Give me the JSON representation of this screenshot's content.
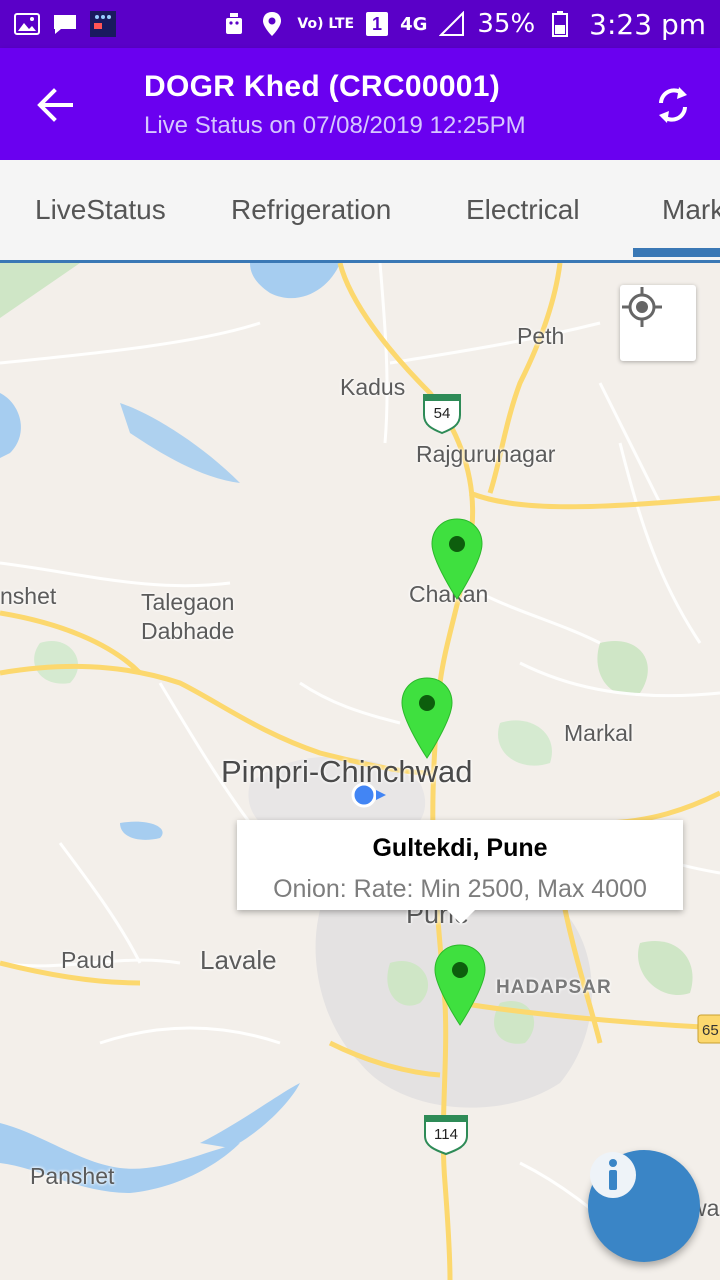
{
  "status_bar": {
    "network_label": "Vo) LTE",
    "sim_slot": "1",
    "network_type": "4G",
    "battery_percent": "35%",
    "time": "3:23 pm",
    "icons": [
      "gallery-icon",
      "message-icon",
      "app-notification-icon",
      "android-icon",
      "location-icon",
      "sim-icon",
      "signal-icon",
      "battery-icon"
    ]
  },
  "appbar": {
    "title": "DOGR Khed (CRC00001)",
    "subtitle": "Live Status on 07/08/2019 12:25PM",
    "icons": [
      "back-arrow-icon",
      "refresh-icon"
    ],
    "colors": {
      "background": "#6a00f0",
      "status_bar": "#5a00c8"
    }
  },
  "tabs": [
    {
      "label": "LiveStatus"
    },
    {
      "label": "Refrigeration"
    },
    {
      "label": "Electrical"
    },
    {
      "label": "Mark",
      "selected": true
    }
  ],
  "map": {
    "labels": {
      "peth": "Peth",
      "kadus": "Kadus",
      "rajgurunagar": "Rajgurunagar",
      "chakan": "Chakan",
      "nshet": "nshet",
      "talegaon": "Talegaon",
      "dabhade": "Dabhade",
      "markal": "Markal",
      "pimpri": "Pimpri-Chinchwad",
      "paud": "Paud",
      "lavale": "Lavale",
      "pune": "Pune",
      "hadapsar": "HADAPSAR",
      "panshet": "Panshet",
      "wa": "wa"
    },
    "highway_shields": [
      "54",
      "114",
      "65"
    ],
    "pins": [
      {
        "name": "chakan",
        "color": "#33dd33"
      },
      {
        "name": "pimpri",
        "color": "#33dd33"
      },
      {
        "name": "gultekdi",
        "color": "#33dd33"
      }
    ],
    "info_window": {
      "title": "Gultekdi, Pune",
      "body": "Onion: Rate: Min 2500, Max 4000"
    },
    "controls": {
      "my_location_icon": "crosshair-icon",
      "fab_icon": "info-icon",
      "fab_color": "#3a85c6"
    }
  }
}
